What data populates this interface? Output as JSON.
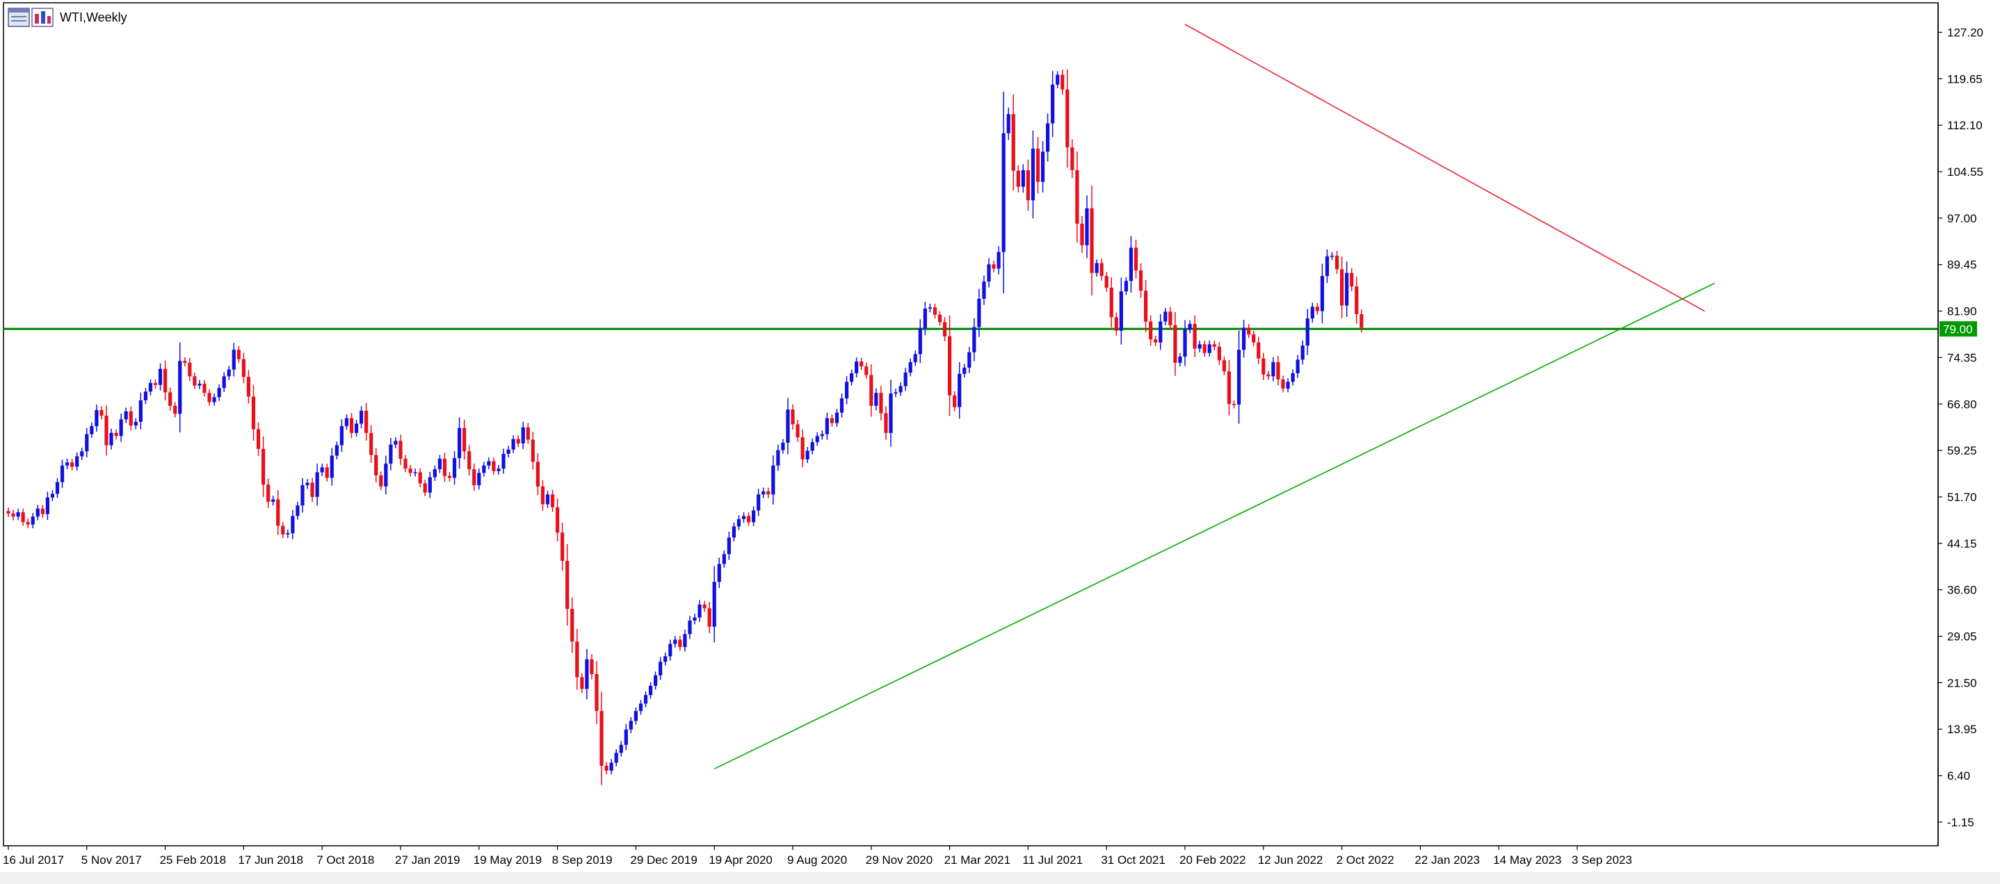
{
  "window": {
    "title": "WTI,Weekly"
  },
  "icons": [
    "chart-window-icon",
    "chart-bars-icon"
  ],
  "colors": {
    "bull": "#1010e0",
    "bear": "#e8101a",
    "support_line": "#00aa00",
    "resistance_line": "#ee2233",
    "level_line": "#008800",
    "level_label_bg": "#009900",
    "frame": "#000000",
    "background": "#ffffff"
  },
  "chart_data": {
    "type": "candlestick",
    "title": "WTI,Weekly",
    "timeframe": "Weekly",
    "ylim": [
      -5.0,
      132.0
    ],
    "grid": false,
    "y_ticks": [
      "127.20",
      "119.65",
      "112.10",
      "104.55",
      "97.00",
      "89.45",
      "81.90",
      "74.35",
      "66.80",
      "59.25",
      "51.70",
      "44.15",
      "36.60",
      "29.05",
      "21.50",
      "13.95",
      "6.40",
      "-1.15"
    ],
    "x_ticks": [
      {
        "label": "16 Jul 2017",
        "i": 0
      },
      {
        "label": "5 Nov 2017",
        "i": 16
      },
      {
        "label": "25 Feb 2018",
        "i": 32
      },
      {
        "label": "17 Jun 2018",
        "i": 48
      },
      {
        "label": "7 Oct 2018",
        "i": 64
      },
      {
        "label": "27 Jan 2019",
        "i": 80
      },
      {
        "label": "19 May 2019",
        "i": 96
      },
      {
        "label": "8 Sep 2019",
        "i": 112
      },
      {
        "label": "29 Dec 2019",
        "i": 128
      },
      {
        "label": "19 Apr 2020",
        "i": 144
      },
      {
        "label": "9 Aug 2020",
        "i": 160
      },
      {
        "label": "29 Nov 2020",
        "i": 176
      },
      {
        "label": "21 Mar 2021",
        "i": 192
      },
      {
        "label": "11 Jul 2021",
        "i": 208
      },
      {
        "label": "31 Oct 2021",
        "i": 224
      },
      {
        "label": "20 Feb 2022",
        "i": 240
      },
      {
        "label": "12 Jun 2022",
        "i": 256
      },
      {
        "label": "2 Oct 2022",
        "i": 272
      },
      {
        "label": "22 Jan 2023",
        "i": 288
      },
      {
        "label": "14 May 2023",
        "i": 304
      },
      {
        "label": "3 Sep 2023",
        "i": 320
      }
    ],
    "level": {
      "value": 79.0,
      "label": "79.00"
    },
    "trendlines": [
      {
        "name": "support",
        "from": {
          "i": 144,
          "price": 7.5
        },
        "to": {
          "i": 334,
          "price": 81.0
        },
        "extend_to_i": 348
      },
      {
        "name": "resistance",
        "from": {
          "i": 240,
          "price": 128.5
        },
        "to": {
          "i": 323,
          "price": 92.0
        },
        "extend_to_i": 346
      }
    ],
    "series": [
      {
        "closes": [
          49,
          48.5,
          49.2,
          47.6,
          47.2,
          48.5,
          49.8,
          48.9,
          51.6,
          52.2,
          54.1,
          56.8,
          57.3,
          56.6,
          58.3,
          59.1,
          61.9,
          63.2,
          65.8,
          64.9,
          60.1,
          62.1,
          61.6,
          64.3,
          65.6,
          63.3,
          63.9,
          67.4,
          68.8,
          70.2,
          69.9,
          72.5,
          68.7,
          66.5,
          65.2,
          73.8,
          73.5,
          71.3,
          69.8,
          70.1,
          68.6,
          67.1,
          67.9,
          69.4,
          71.3,
          72.4,
          75.6,
          74.1,
          71.2,
          68.0,
          62.7,
          59.5,
          53.7,
          50.9,
          51.3,
          47.0,
          45.6,
          45.8,
          48.6,
          50.3,
          53.6,
          54.0,
          51.7,
          55.7,
          56.5,
          54.8,
          58.4,
          60.1,
          63.2,
          64.5,
          62.1,
          63.6,
          65.7,
          62.1,
          58.5,
          55.2,
          53.4,
          57.1,
          60.2,
          60.8,
          57.9,
          56.3,
          55.6,
          55.7,
          53.9,
          52.4,
          54.9,
          56.2,
          57.9,
          55.1,
          54.8,
          58.0,
          62.9,
          59.1,
          56.2,
          53.6,
          55.6,
          56.8,
          57.5,
          55.9,
          56.3,
          58.7,
          59.4,
          61.1,
          60.4,
          63.0,
          61.0,
          57.4,
          53.4,
          50.5,
          52.1,
          50.0,
          45.9,
          41.3,
          33.5,
          28.2,
          22.4,
          20.5,
          25.3,
          22.9,
          16.9,
          8.0,
          7.2,
          8.5,
          10.1,
          11.4,
          13.9,
          15.3,
          16.9,
          18.1,
          19.5,
          21.0,
          22.7,
          24.9,
          25.8,
          27.8,
          28.5,
          27.3,
          29.4,
          31.6,
          32.1,
          34.2,
          33.6,
          30.6,
          37.9,
          40.8,
          42.4,
          45.1,
          46.9,
          48.1,
          48.6,
          47.6,
          49.5,
          52.1,
          52.6,
          52.1,
          56.8,
          59.3,
          60.5,
          65.9,
          63.5,
          61.4,
          57.8,
          59.2,
          60.6,
          61.6,
          61.9,
          64.5,
          63.7,
          65.4,
          67.7,
          70.4,
          71.8,
          73.7,
          72.9,
          71.5,
          66.5,
          68.6,
          65.3,
          62.1,
          68.5,
          68.7,
          69.7,
          71.9,
          73.6,
          74.9,
          79.1,
          82.3,
          82.5,
          81.3,
          80.1,
          77.8,
          68.2,
          66.3,
          71.7,
          72.7,
          75.2,
          79.3,
          83.9,
          86.7,
          89.5,
          88.8,
          91.5,
          110.8,
          113.9,
          104.7,
          102.1,
          104.8,
          99.9,
          108.3,
          102.9,
          107.8,
          112.4,
          118.7,
          120.3,
          117.9,
          108.5,
          104.8,
          96.1,
          92.6,
          98.6,
          88.1,
          89.7,
          87.6,
          85.7,
          80.9,
          78.7,
          85.1,
          86.8,
          92.2,
          88.5,
          85.2,
          80.2,
          77.3,
          76.8,
          80.2,
          81.8,
          79.6,
          73.5,
          74.5,
          78.9,
          79.8,
          75.8,
          76.5,
          75.1,
          76.5,
          76.1,
          73.9,
          72.1,
          66.8,
          66.7,
          75.6,
          79.2,
          78.1,
          76.8,
          74.2,
          71.6,
          71.3,
          73.6,
          70.8,
          69.3,
          70.4,
          71.8,
          74.0,
          76.3,
          80.7,
          82.6,
          81.9,
          87.6,
          90.8,
          90.9,
          88.7,
          82.8,
          88.1,
          85.9,
          81.4,
          79.2
        ]
      }
    ]
  }
}
